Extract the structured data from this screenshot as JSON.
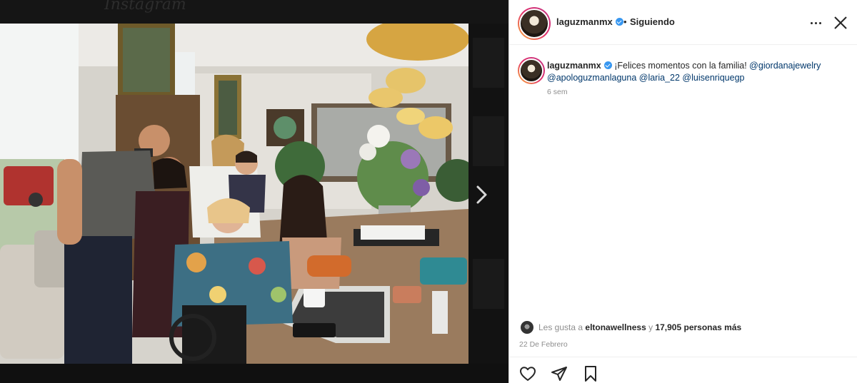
{
  "background": {
    "logo_text": "Instagram"
  },
  "post": {
    "username": "laguzmanmx",
    "separator": "•",
    "follow_status": "Siguiendo",
    "caption": {
      "username": "laguzmanmx",
      "text": "¡Felices momentos con la familia!",
      "mentions": [
        "@giordanajewelry",
        "@apologuzmanlaguna",
        "@laria_22",
        "@luisenriquegp"
      ]
    },
    "time_ago": "6 sem",
    "likes": {
      "prefix": "Les gusta a",
      "user": "eltonawellness",
      "middle": "y",
      "count": "17,905 personas más"
    },
    "date": "22 De Febrero"
  },
  "icons": {
    "verified": "verified-badge-icon",
    "more": "more-options-icon",
    "close": "close-icon",
    "next": "chevron-right-icon",
    "like": "heart-icon",
    "comment": "comment-icon",
    "share": "paper-plane-icon",
    "save": "bookmark-icon"
  },
  "colors": {
    "verified": "#3897f0",
    "mention": "#00376b",
    "text": "#262626",
    "muted": "#8e8e8e"
  }
}
